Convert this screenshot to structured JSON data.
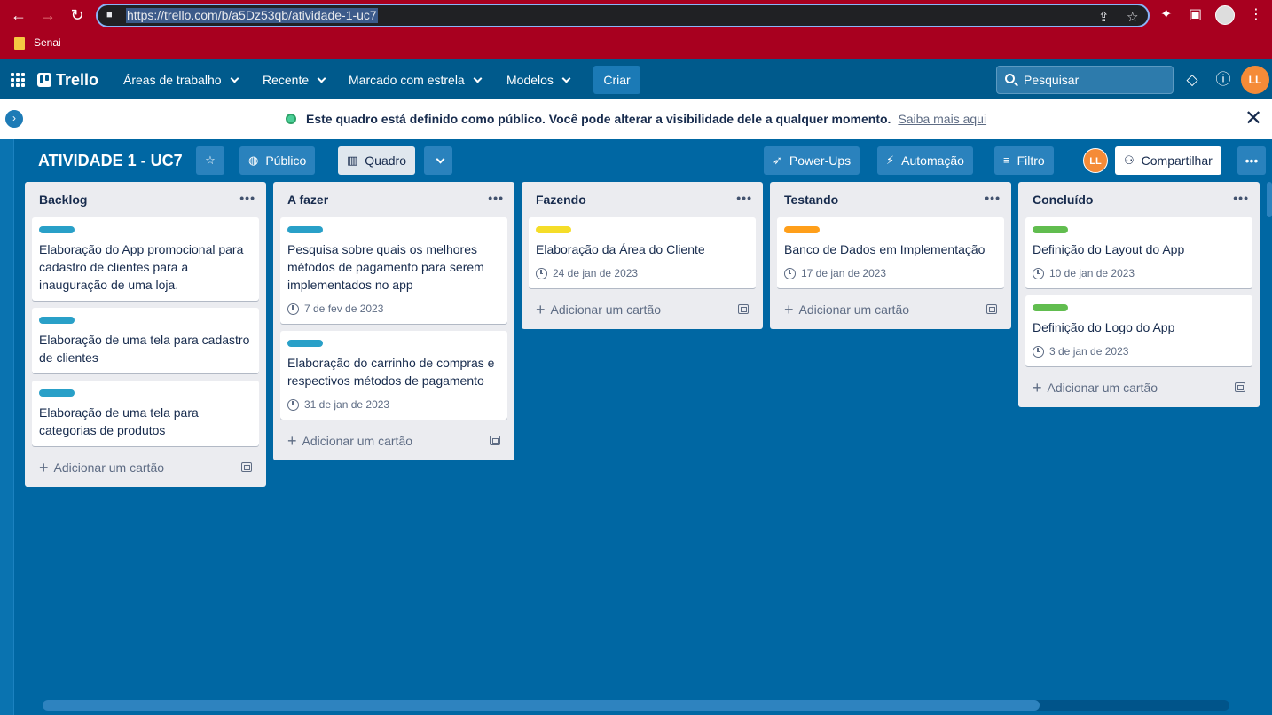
{
  "browser": {
    "url": "https://trello.com/b/a5Dz53qb/atividade-1-uc7",
    "bookmark": "Senai"
  },
  "header": {
    "logo": "Trello",
    "menu": [
      "Áreas de trabalho",
      "Recente",
      "Marcado com estrela",
      "Modelos"
    ],
    "create": "Criar",
    "search_placeholder": "Pesquisar",
    "avatar": "LL"
  },
  "notice": {
    "text": "Este quadro está definido como público. Você pode alterar a visibilidade dele a qualquer momento.",
    "link": "Saiba mais aqui"
  },
  "board": {
    "title": "ATIVIDADE 1 - UC7",
    "visibility": "Público",
    "view": "Quadro",
    "powerups": "Power-Ups",
    "automation": "Automação",
    "filter": "Filtro",
    "member": "LL",
    "share": "Compartilhar"
  },
  "add_card_label": "Adicionar um cartão",
  "colors": {
    "blue": "#29a0c8",
    "yellow": "#f5dd29",
    "orange": "#ff9f1a",
    "green": "#61bd4f"
  },
  "lists": [
    {
      "title": "Backlog",
      "cards": [
        {
          "title": "Elaboração do App promocional para cadastro de clientes para a inauguração de uma loja.",
          "label": "blue",
          "due": ""
        },
        {
          "title": "Elaboração de uma tela para cadastro de clientes",
          "label": "blue",
          "due": ""
        },
        {
          "title": "Elaboração de uma tela para categorias de produtos",
          "label": "blue",
          "due": ""
        }
      ]
    },
    {
      "title": "A fazer",
      "cards": [
        {
          "title": "Pesquisa sobre quais os melhores métodos de pagamento para serem implementados no app",
          "label": "blue",
          "due": "7 de fev de 2023"
        },
        {
          "title": "Elaboração do carrinho de compras e respectivos métodos de pagamento",
          "label": "blue",
          "due": "31 de jan de 2023"
        }
      ]
    },
    {
      "title": "Fazendo",
      "cards": [
        {
          "title": "Elaboração da Área do Cliente",
          "label": "yellow",
          "due": "24 de jan de 2023"
        }
      ]
    },
    {
      "title": "Testando",
      "cards": [
        {
          "title": "Banco de Dados em Implementação",
          "label": "orange",
          "due": "17 de jan de 2023"
        }
      ]
    },
    {
      "title": "Concluído",
      "cards": [
        {
          "title": "Definição do Layout do App",
          "label": "green",
          "due": "10 de jan de 2023"
        },
        {
          "title": "Definição do Logo do App",
          "label": "green",
          "due": "3 de jan de 2023"
        }
      ]
    }
  ]
}
